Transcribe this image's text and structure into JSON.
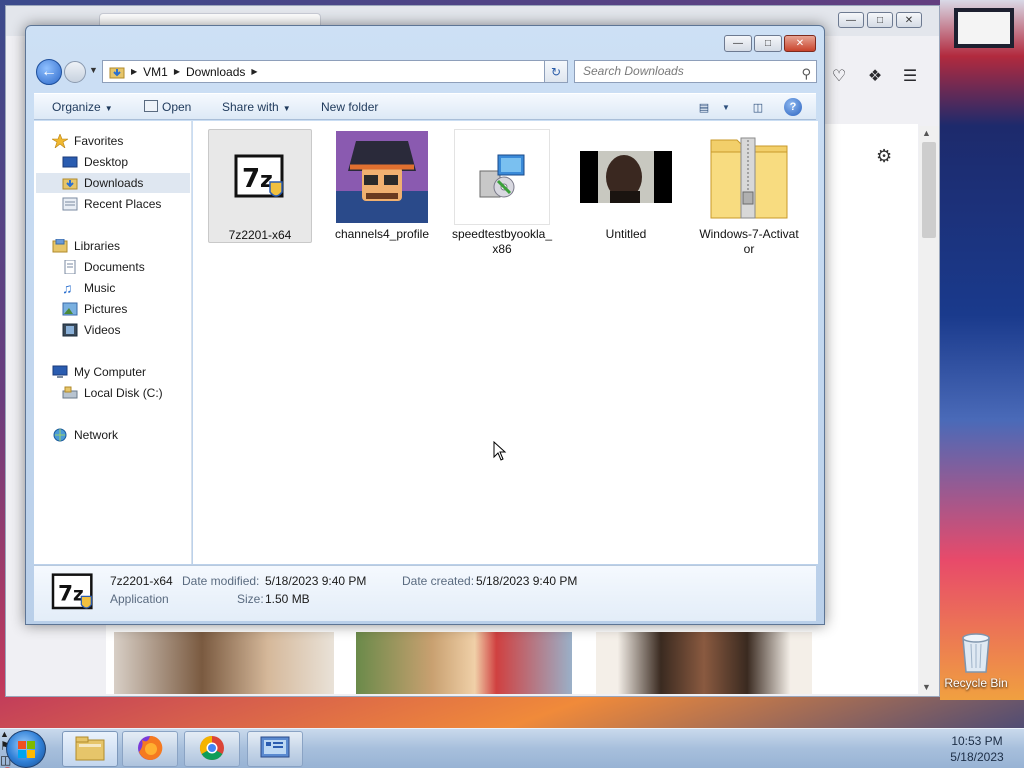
{
  "explorer": {
    "address": [
      "VM1",
      "Downloads"
    ],
    "search_placeholder": "Search Downloads",
    "commands": {
      "organize": "Organize",
      "open": "Open",
      "share_with": "Share with",
      "new_folder": "New folder"
    },
    "nav": {
      "favorites": "Favorites",
      "desktop": "Desktop",
      "downloads": "Downloads",
      "recent_places": "Recent Places",
      "libraries": "Libraries",
      "documents": "Documents",
      "music": "Music",
      "pictures": "Pictures",
      "videos": "Videos",
      "my_computer": "My Computer",
      "local_disk": "Local Disk (C:)",
      "network": "Network"
    },
    "files": [
      {
        "name": "7z2201-x64",
        "icon": "7zip-installer-icon"
      },
      {
        "name": "channels4_profile",
        "icon": "image-thumbnail"
      },
      {
        "name": "speedtestbyookla_x86",
        "icon": "installer-package-icon"
      },
      {
        "name": "Untitled",
        "icon": "video-thumbnail"
      },
      {
        "name": "Windows-7-Activator",
        "icon": "zip-folder-icon"
      }
    ],
    "details": {
      "name": "7z2201-x64",
      "type": "Application",
      "date_modified_label": "Date modified:",
      "date_modified": "5/18/2023 9:40 PM",
      "date_created_label": "Date created:",
      "date_created": "5/18/2023 9:40 PM",
      "size_label": "Size:",
      "size": "1.50 MB"
    }
  },
  "desktop": {
    "recycle_bin": "Recycle Bin"
  },
  "taskbar": {
    "time": "10:53 PM",
    "date": "5/18/2023"
  }
}
